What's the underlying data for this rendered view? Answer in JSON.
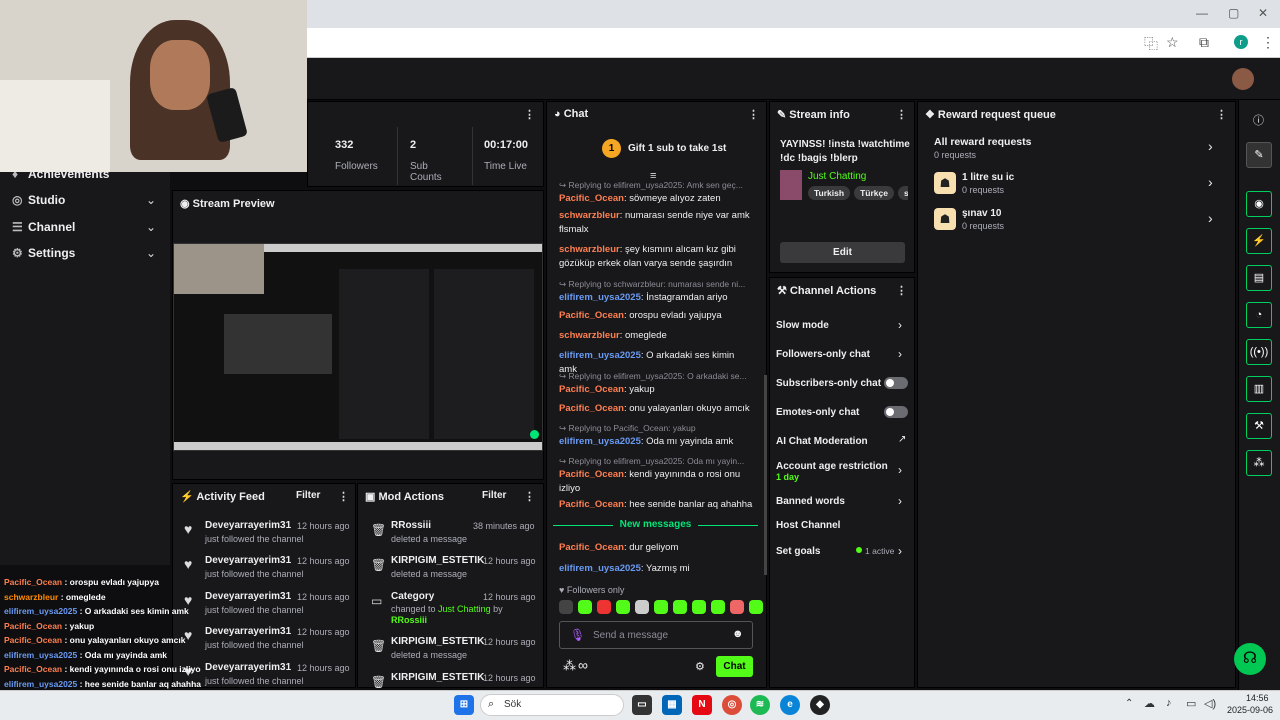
{
  "browser": {
    "translate_icon": "translate-icon",
    "bookmark_icon": "star-icon",
    "ext_icon": "puzzle-icon",
    "profile_letter": "r"
  },
  "nav": {
    "achievements": "Achievements",
    "studio": "Studio",
    "channel": "Channel",
    "settings": "Settings"
  },
  "stats": {
    "followers_num": "332",
    "followers_label": "Followers",
    "subs_num": "2",
    "subs_label": "Sub Counts",
    "time_num": "00:17:00",
    "time_label": "Time Live"
  },
  "preview": {
    "title": "Stream Preview"
  },
  "chat": {
    "title": "Chat",
    "gift": "Gift 1 sub to take 1st",
    "gift_rank": "1",
    "messages": [
      {
        "reply": "Replying to elifirem_uysa2025: Amk sen geç...",
        "user": "Pacific_Ocean",
        "text": ": sövmeye alıyoz zaten"
      },
      {
        "user": "schwarzbleur",
        "text": ": numarası sende niye var amk flsmalx"
      },
      {
        "user": "schwarzbleur",
        "text": ": şey kısmını alıcam kız gibi gözüküp erkek olan varya sende şaşırdın"
      },
      {
        "reply": "Replying to schwarzbleur: numarası sende ni...",
        "user": "elifirem_uysa2025",
        "text": ": İnstagramdan ariyo"
      },
      {
        "user": "Pacific_Ocean",
        "text": ": orospu evladı yajupya"
      },
      {
        "user": "schwarzbleur",
        "text": ": omeglede"
      },
      {
        "user": "elifirem_uysa2025",
        "text": ": O arkadaki ses kimin amk"
      },
      {
        "reply": "Replying to elifirem_uysa2025: O arkadaki se...",
        "user": "Pacific_Ocean",
        "text": ": yakup"
      },
      {
        "user": "Pacific_Ocean",
        "text": ": onu yalayanları okuyo amcık"
      },
      {
        "reply": "Replying to Pacific_Ocean: yakup",
        "user": "elifirem_uysa2025",
        "text": ": Oda mı yayinda amk"
      },
      {
        "reply": "Replying to elifirem_uysa2025: Oda mı yayin...",
        "user": "Pacific_Ocean",
        "text": ": kendi yayınında o rosi onu izliyo"
      },
      {
        "user": "Pacific_Ocean",
        "text": ": hee senide banlar aq ahahha"
      }
    ],
    "new_messages": "New messages",
    "new": [
      {
        "user": "Pacific_Ocean",
        "text": ": dur geliyom"
      },
      {
        "user": "elifirem_uysa2025",
        "text": ": Yazmış mi"
      }
    ],
    "followers_only": "♥ Followers only",
    "placeholder": "Send a message",
    "send": "Chat"
  },
  "stream_info": {
    "title_label": "Stream info",
    "stream_title": "YAYINSS! !insta !watchtime !dc !bagis !blerp",
    "category": "Just Chatting",
    "tags": [
      "Turkish",
      "Türkçe",
      "s"
    ],
    "edit": "Edit"
  },
  "channel_actions": {
    "title": "Channel Actions",
    "slow": "Slow mode",
    "followers": "Followers-only chat",
    "subscribers": "Subscribers-only chat",
    "emotes": "Emotes-only chat",
    "ai": "AI Chat Moderation",
    "age": "Account age restriction",
    "age_val": "1 day",
    "banned": "Banned words",
    "host": "Host Channel",
    "goals": "Set goals",
    "goals_status": "1 active"
  },
  "reward": {
    "title": "Reward request queue",
    "all": "All reward requests",
    "all_count": "0 requests",
    "items": [
      {
        "name": "1 litre su ic",
        "count": "0 requests"
      },
      {
        "name": "şınav 10",
        "count": "0 requests"
      }
    ]
  },
  "activity": {
    "title": "Activity Feed",
    "filter": "Filter",
    "items": [
      {
        "name": "Deveyarrayerim31",
        "time": "12 hours ago",
        "sub": "just followed the channel"
      },
      {
        "name": "Deveyarrayerim31",
        "time": "12 hours ago",
        "sub": "just followed the channel"
      },
      {
        "name": "Deveyarrayerim31",
        "time": "12 hours ago",
        "sub": "just followed the channel"
      },
      {
        "name": "Deveyarrayerim31",
        "time": "12 hours ago",
        "sub": "just followed the channel"
      },
      {
        "name": "Deveyarrayerim31",
        "time": "12 hours ago",
        "sub": "just followed the channel"
      }
    ]
  },
  "mod": {
    "title": "Mod Actions",
    "filter": "Filter",
    "items": [
      {
        "name": "RRossiii",
        "time": "38 minutes ago",
        "sub": "deleted a message"
      },
      {
        "name": "KIRPIGIM_ESTETIK",
        "time": "12 hours ago",
        "sub": "deleted a message"
      },
      {
        "name": "Category",
        "time": "12 hours ago",
        "sub": "changed to",
        "cat": "Just Chatting",
        "by": "by",
        "who": "RRossiii"
      },
      {
        "name": "KIRPIGIM_ESTETIK",
        "time": "12 hours ago",
        "sub": "deleted a message"
      },
      {
        "name": "KIRPIGIM_ESTETIK",
        "time": "12 hours ago",
        "sub": ""
      }
    ]
  },
  "overlay": [
    {
      "u": "Pacific_Ocean",
      "t": " : orospu evladı yajupya",
      "c": "#ff7f50"
    },
    {
      "u": "schwarzbleur",
      "t": " : omeglede",
      "c": "#ff8c00"
    },
    {
      "u": "elifirem_uysa2025",
      "t": " : O arkadaki ses kimin amk",
      "c": "#6a9bf4"
    },
    {
      "u": "Pacific_Ocean",
      "t": " : yakup",
      "c": "#ff7f50"
    },
    {
      "u": "Pacific_Ocean",
      "t": " : onu yalayanları okuyo amcık",
      "c": "#ff7f50"
    },
    {
      "u": "elifirem_uysa2025",
      "t": " : Oda mı yayinda amk",
      "c": "#6a9bf4"
    },
    {
      "u": "Pacific_Ocean",
      "t": " : kendi yayınında o rosi onu izliyo",
      "c": "#ff7f50"
    },
    {
      "u": "elifirem_uysa2025",
      "t": " : hee senide banlar aq ahahha",
      "c": "#6a9bf4"
    },
    {
      "u": "Pacific_Ocean",
      "t": " : dur geliyom",
      "c": "#ff7f50"
    },
    {
      "u": "elifirem_uysa2025",
      "t": " : Yazmış mi",
      "c": "#6a9bf4"
    }
  ],
  "taskbar": {
    "search": "Sök",
    "time": "14:56",
    "date": "2025-09-06"
  }
}
